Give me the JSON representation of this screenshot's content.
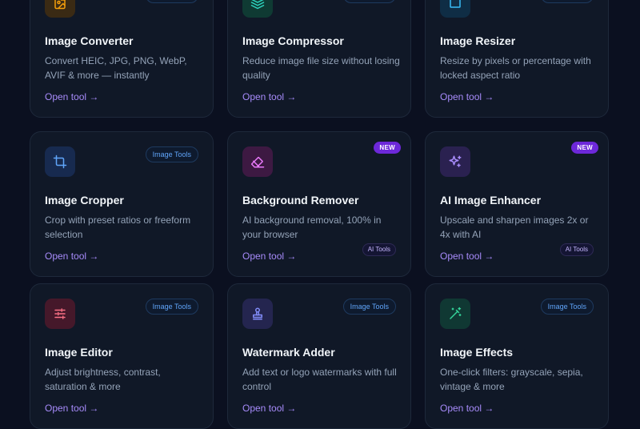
{
  "open_link_label": "Open tool →",
  "badges": {
    "image_tools": "Image Tools",
    "ai_tools": "AI Tools",
    "new": "NEW"
  },
  "colors": {
    "page_bg": "#0b1020",
    "card_bg": "#101827",
    "link": "#a78bfa",
    "badge_text": "#60a5fa"
  },
  "tools": [
    {
      "title": "Image Converter",
      "desc": "Convert HEIC, JPG, PNG, WebP, AVIF & more — instantly",
      "icon": "image-file-icon"
    },
    {
      "title": "Image Compressor",
      "desc": "Reduce image file size without losing quality",
      "icon": "layers-icon"
    },
    {
      "title": "Image Resizer",
      "desc": "Resize by pixels or percentage with locked aspect ratio",
      "icon": "square-icon"
    },
    {
      "title": "Image Cropper",
      "desc": "Crop with preset ratios or freeform selection",
      "icon": "crop-icon"
    },
    {
      "title": "Background Remover",
      "desc": "AI background removal, 100% in your browser",
      "icon": "eraser-icon"
    },
    {
      "title": "AI Image Enhancer",
      "desc": "Upscale and sharpen images 2x or 4x with AI",
      "icon": "sparkles-icon"
    },
    {
      "title": "Image Editor",
      "desc": "Adjust brightness, contrast, saturation & more",
      "icon": "sliders-icon"
    },
    {
      "title": "Watermark Adder",
      "desc": "Add text or logo watermarks with full control",
      "icon": "stamp-icon"
    },
    {
      "title": "Image Effects",
      "desc": "One-click filters: grayscale, sepia, vintage & more",
      "icon": "magic-wand-icon"
    }
  ]
}
